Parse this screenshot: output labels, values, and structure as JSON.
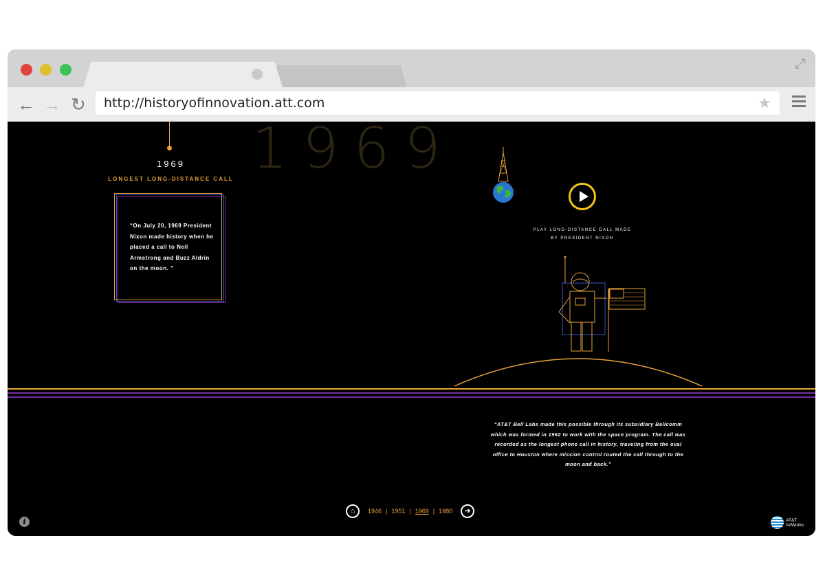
{
  "browser": {
    "url": "http://historyofinnovation.att.com",
    "traffic_lights": {
      "close": "#e0443e",
      "minimize": "#dfc02c",
      "zoom": "#3dc25a"
    }
  },
  "page": {
    "big_year": "1969",
    "year_label": "1969",
    "headline": "LONGEST LONG-DISTANCE CALL",
    "quote": "“On July 20, 1969 President Nixon made history when he placed a call to Neil Armstrong and Buzz Aldrin on the moon. ”",
    "play_caption_line1": "PLAY LONG-DISTANCE CALL MADE",
    "play_caption_line2": "BY PRESIDENT NIXON",
    "bottom_quote": "“AT&T Bell Labs made this possible through its subsidiary Bellcomm which was formed in 1962 to work with the space program. The call was recorded as the longest phone call in history, traveling from the oval office to Houston where mission control routed the call through to the moon and back.”",
    "accent_color": "#e8a23a"
  },
  "timeline_nav": {
    "years": [
      "1946",
      "1951",
      "1969",
      "1980"
    ],
    "current": "1969",
    "separator": "|"
  },
  "footer": {
    "info_glyph": "i",
    "brand_line1": "AT&T",
    "brand_line2": "AdWorks"
  }
}
